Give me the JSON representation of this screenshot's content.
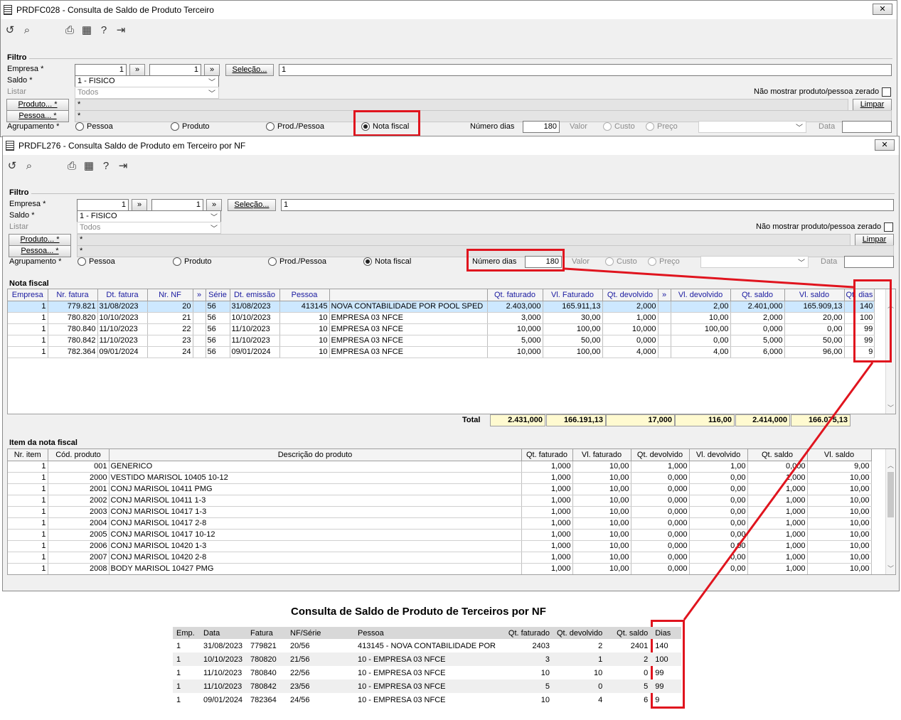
{
  "back_window": {
    "title": "PRDFC028 - Consulta de Saldo de Produto Terceiro",
    "close_label": "✕",
    "filter_label": "Filtro",
    "empresa_label": "Empresa *",
    "empresa_from": "1",
    "empresa_to": "1",
    "range_button": "»",
    "selecao_button": "Seleção...",
    "selecao_value": "1",
    "saldo_label": "Saldo *",
    "saldo_value": "1 - FISICO",
    "listar_label": "Listar",
    "listar_value": "Todos",
    "nao_mostrar_label": "Não mostrar produto/pessoa zerado",
    "produto_button": "Produto... *",
    "produto_value": "*",
    "pessoa_button": "Pessoa... *",
    "pessoa_value": "*",
    "limpar_button": "Limpar",
    "agrupamento_label": "Agrupamento *",
    "radio_pessoa": "Pessoa",
    "radio_produto": "Produto",
    "radio_prodpessoa": "Prod./Pessoa",
    "radio_nota": "Nota fiscal",
    "numero_dias_label": "Número dias",
    "numero_dias_value": "180",
    "valor_label": "Valor",
    "radio_custo": "Custo",
    "radio_preco": "Preço",
    "data_label": "Data"
  },
  "front_window": {
    "title": "PRDFL276 - Consulta Saldo de Produto em Terceiro por NF",
    "close_label": "✕",
    "filter_label": "Filtro",
    "empresa_label": "Empresa *",
    "empresa_from": "1",
    "empresa_to": "1",
    "range_button": "»",
    "selecao_button": "Seleção...",
    "selecao_value": "1",
    "saldo_label": "Saldo *",
    "saldo_value": "1 - FISICO",
    "listar_label": "Listar",
    "listar_value": "Todos",
    "nao_mostrar_label": "Não mostrar produto/pessoa zerado",
    "produto_button": "Produto... *",
    "produto_value": "*",
    "pessoa_button": "Pessoa... *",
    "pessoa_value": "*",
    "limpar_button": "Limpar",
    "agrupamento_label": "Agrupamento *",
    "radio_pessoa": "Pessoa",
    "radio_produto": "Produto",
    "radio_prodpessoa": "Prod./Pessoa",
    "radio_nota": "Nota fiscal",
    "numero_dias_label": "Número dias",
    "numero_dias_value": "180",
    "valor_label": "Valor",
    "radio_custo": "Custo",
    "radio_preco": "Preço",
    "data_label": "Data",
    "nota_fiscal": {
      "section_label": "Nota fiscal",
      "columns": [
        "Empresa",
        "Nr. fatura",
        "Dt. fatura",
        "Nr. NF",
        "»",
        "Série",
        "Dt. emissão",
        "Pessoa",
        "",
        "Qt. faturado",
        "Vl. Faturado",
        "Qt. devolvido",
        "»",
        "Vl. devolvido",
        "Qt. saldo",
        "Vl. saldo",
        "Qt. dias"
      ],
      "rows": [
        [
          "1",
          "779.821",
          "31/08/2023",
          "20",
          "56",
          "31/08/2023",
          "413145",
          "NOVA CONTABILIDADE POR POOL SPED",
          "2.403,000",
          "165.911,13",
          "2,000",
          "2,00",
          "2.401,000",
          "165.909,13",
          "140"
        ],
        [
          "1",
          "780.820",
          "10/10/2023",
          "21",
          "56",
          "10/10/2023",
          "10",
          "EMPRESA 03 NFCE",
          "3,000",
          "30,00",
          "1,000",
          "10,00",
          "2,000",
          "20,00",
          "100"
        ],
        [
          "1",
          "780.840",
          "11/10/2023",
          "22",
          "56",
          "11/10/2023",
          "10",
          "EMPRESA 03 NFCE",
          "10,000",
          "100,00",
          "10,000",
          "100,00",
          "0,000",
          "0,00",
          "99"
        ],
        [
          "1",
          "780.842",
          "11/10/2023",
          "23",
          "56",
          "11/10/2023",
          "10",
          "EMPRESA 03 NFCE",
          "5,000",
          "50,00",
          "0,000",
          "0,00",
          "5,000",
          "50,00",
          "99"
        ],
        [
          "1",
          "782.364",
          "09/01/2024",
          "24",
          "56",
          "09/01/2024",
          "10",
          "EMPRESA 03 NFCE",
          "10,000",
          "100,00",
          "4,000",
          "4,00",
          "6,000",
          "96,00",
          "9"
        ]
      ],
      "total_label": "Total",
      "totals": [
        "2.431,000",
        "166.191,13",
        "17,000",
        "116,00",
        "2.414,000",
        "166.075,13"
      ]
    },
    "item_nota": {
      "section_label": "Item da nota fiscal",
      "columns": [
        "Nr. item",
        "Cód. produto",
        "Descrição do produto",
        "Qt. faturado",
        "Vl. faturado",
        "Qt. devolvido",
        "Vl. devolvido",
        "Qt. saldo",
        "Vl. saldo"
      ],
      "rows": [
        [
          "1",
          "001",
          "GENERICO",
          "1,000",
          "10,00",
          "1,000",
          "1,00",
          "0,000",
          "9,00"
        ],
        [
          "1",
          "2000",
          "VESTIDO MARISOL 10405 10-12",
          "1,000",
          "10,00",
          "0,000",
          "0,00",
          "1,000",
          "10,00"
        ],
        [
          "1",
          "2001",
          "CONJ MARISOL 10411 PMG",
          "1,000",
          "10,00",
          "0,000",
          "0,00",
          "1,000",
          "10,00"
        ],
        [
          "1",
          "2002",
          "CONJ MARISOL 10411 1-3",
          "1,000",
          "10,00",
          "0,000",
          "0,00",
          "1,000",
          "10,00"
        ],
        [
          "1",
          "2003",
          "CONJ MARISOL 10417 1-3",
          "1,000",
          "10,00",
          "0,000",
          "0,00",
          "1,000",
          "10,00"
        ],
        [
          "1",
          "2004",
          "CONJ MARISOL 10417 2-8",
          "1,000",
          "10,00",
          "0,000",
          "0,00",
          "1,000",
          "10,00"
        ],
        [
          "1",
          "2005",
          "CONJ MARISOL 10417 10-12",
          "1,000",
          "10,00",
          "0,000",
          "0,00",
          "1,000",
          "10,00"
        ],
        [
          "1",
          "2006",
          "CONJ MARISOL 10420 1-3",
          "1,000",
          "10,00",
          "0,000",
          "0,00",
          "1,000",
          "10,00"
        ],
        [
          "1",
          "2007",
          "CONJ MARISOL 10420 2-8",
          "1,000",
          "10,00",
          "0,000",
          "0,00",
          "1,000",
          "10,00"
        ],
        [
          "1",
          "2008",
          "BODY MARISOL 10427 PMG",
          "1,000",
          "10,00",
          "0,000",
          "0,00",
          "1,000",
          "10,00"
        ]
      ]
    }
  },
  "report": {
    "title": "Consulta de Saldo de Produto de Terceiros por NF",
    "columns": [
      "Emp.",
      "Data",
      "Fatura",
      "NF/Série",
      "Pessoa",
      "Qt. faturado",
      "Qt. devolvido",
      "Qt. saldo",
      "Dias"
    ],
    "rows": [
      [
        "1",
        "31/08/2023",
        "779821",
        "20/56",
        "413145 - NOVA CONTABILIDADE POR",
        "2403",
        "2",
        "2401",
        "140"
      ],
      [
        "1",
        "10/10/2023",
        "780820",
        "21/56",
        "10 - EMPRESA 03 NFCE",
        "3",
        "1",
        "2",
        "100"
      ],
      [
        "1",
        "11/10/2023",
        "780840",
        "22/56",
        "10 - EMPRESA 03 NFCE",
        "10",
        "10",
        "0",
        "99"
      ],
      [
        "1",
        "11/10/2023",
        "780842",
        "23/56",
        "10 - EMPRESA 03 NFCE",
        "5",
        "0",
        "5",
        "99"
      ],
      [
        "1",
        "09/01/2024",
        "782364",
        "24/56",
        "10 - EMPRESA 03 NFCE",
        "10",
        "4",
        "6",
        "9"
      ]
    ]
  },
  "colors": {
    "highlight": "#e0141e",
    "selected_row": "#cde8ff",
    "total_bg": "#fffad0",
    "header_text": "#1a1aa0"
  }
}
